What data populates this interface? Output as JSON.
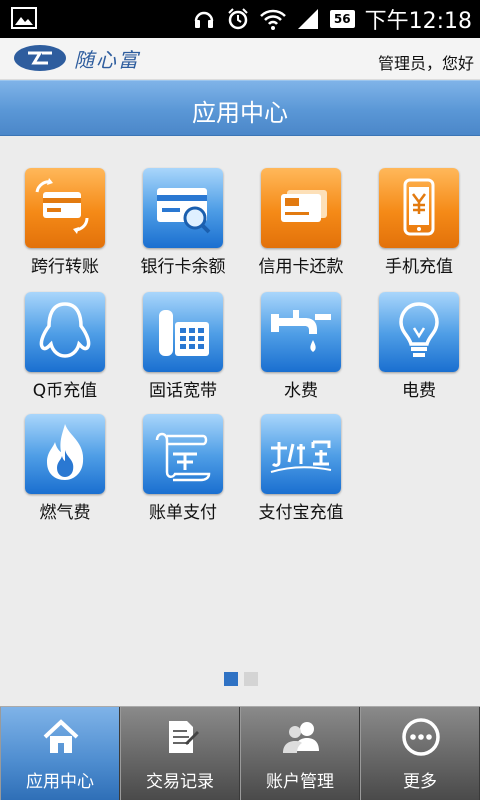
{
  "status_bar": {
    "time": "下午12:18",
    "battery": "56"
  },
  "brand": {
    "logo_text": "随心富",
    "greeting": "管理员，您好"
  },
  "title": "应用中心",
  "apps": [
    {
      "label": "跨行转账",
      "icon": "card-transfer-icon",
      "color": "orange"
    },
    {
      "label": "银行卡余额",
      "icon": "card-search-icon",
      "color": "blue"
    },
    {
      "label": "信用卡还款",
      "icon": "visa-card-icon",
      "color": "orange"
    },
    {
      "label": "手机充值",
      "icon": "phone-yuan-icon",
      "color": "orange"
    },
    {
      "label": "Q币充值",
      "icon": "qq-penguin-icon",
      "color": "blue"
    },
    {
      "label": "固话宽带",
      "icon": "telephone-icon",
      "color": "blue"
    },
    {
      "label": "水费",
      "icon": "water-tap-icon",
      "color": "blue"
    },
    {
      "label": "电费",
      "icon": "light-bulb-icon",
      "color": "blue"
    },
    {
      "label": "燃气费",
      "icon": "flame-icon",
      "color": "blue"
    },
    {
      "label": "账单支付",
      "icon": "alipay-bill-icon",
      "color": "blue"
    },
    {
      "label": "支付宝充值",
      "icon": "alipay-logo-icon",
      "color": "blue"
    }
  ],
  "pager": {
    "pages": 2,
    "current": 1
  },
  "bottom_nav": [
    {
      "label": "应用中心",
      "icon": "home-icon",
      "active": true
    },
    {
      "label": "交易记录",
      "icon": "document-icon",
      "active": false
    },
    {
      "label": "账户管理",
      "icon": "users-icon",
      "active": false
    },
    {
      "label": "更多",
      "icon": "more-icon",
      "active": false
    }
  ]
}
